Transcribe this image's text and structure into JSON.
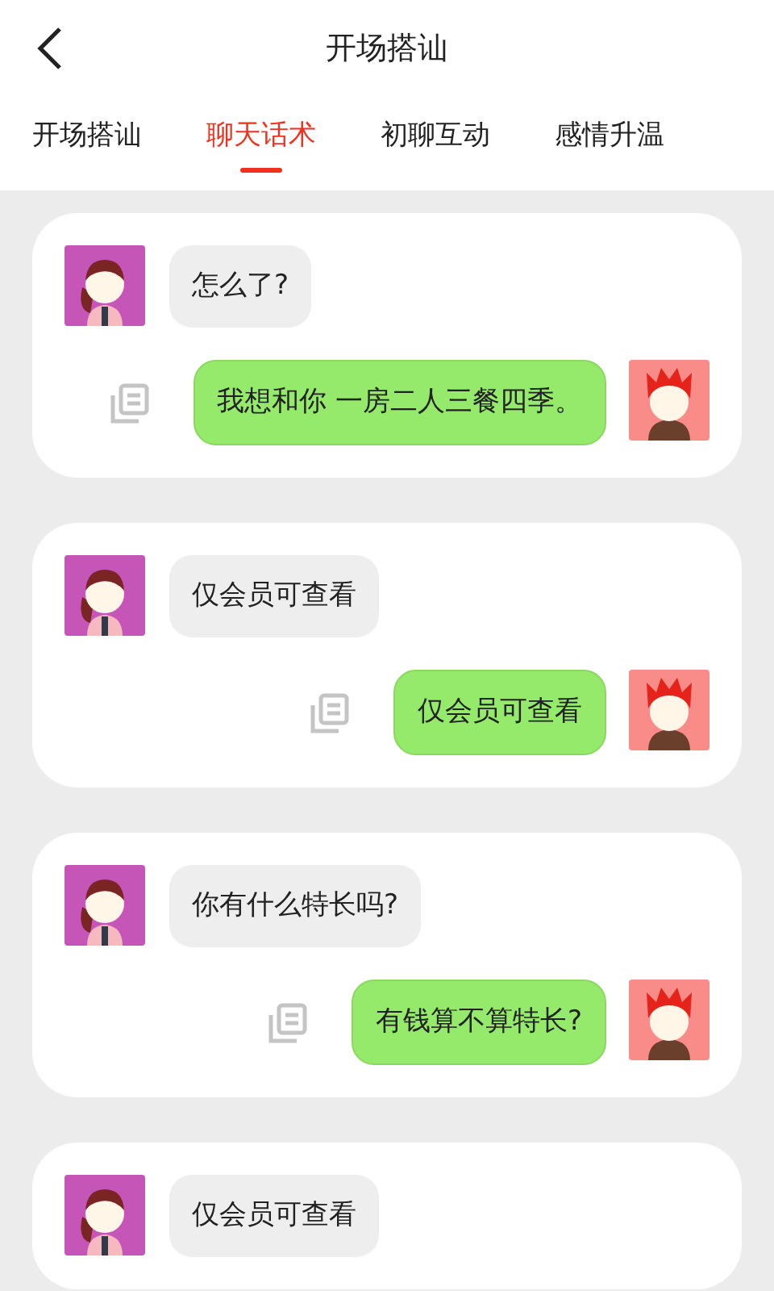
{
  "header": {
    "title": "开场搭讪"
  },
  "tabs": [
    {
      "label": "开场搭讪",
      "selected": false
    },
    {
      "label": "聊天话术",
      "selected": true
    },
    {
      "label": "初聊互动",
      "selected": false
    },
    {
      "label": "感情升温",
      "selected": false
    }
  ],
  "cards": [
    {
      "messages": [
        {
          "kind": "received",
          "text": "怎么了?"
        },
        {
          "kind": "sent",
          "text": "我想和你 一房二人三餐四季。"
        }
      ]
    },
    {
      "messages": [
        {
          "kind": "received",
          "text": "仅会员可查看"
        },
        {
          "kind": "sent",
          "text": "仅会员可查看"
        }
      ]
    },
    {
      "messages": [
        {
          "kind": "received",
          "text": "你有什么特长吗?"
        },
        {
          "kind": "sent",
          "text": "有钱算不算特长?"
        }
      ]
    },
    {
      "messages": [
        {
          "kind": "received",
          "text": "仅会员可查看"
        }
      ]
    }
  ]
}
